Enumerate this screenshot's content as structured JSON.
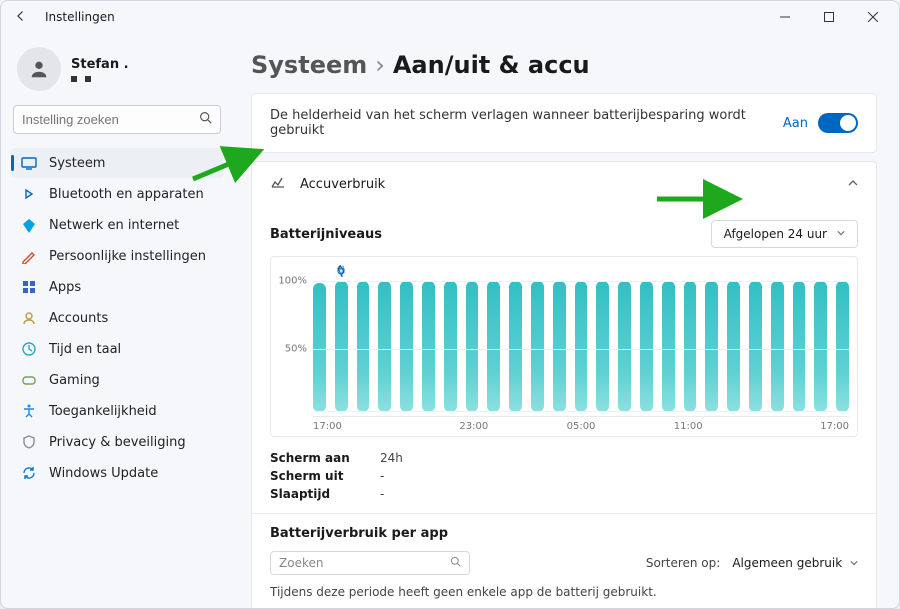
{
  "window": {
    "app_title": "Instellingen"
  },
  "user": {
    "name": "Stefan ."
  },
  "search": {
    "placeholder": "Instelling zoeken"
  },
  "nav": {
    "items": [
      {
        "key": "systeem",
        "label": "Systeem",
        "color": "#0067c0"
      },
      {
        "key": "bluetooth",
        "label": "Bluetooth en apparaten",
        "color": "#0067c0"
      },
      {
        "key": "netwerk",
        "label": "Netwerk en internet",
        "color": "#00a3e0"
      },
      {
        "key": "persoonlijk",
        "label": "Persoonlijke instellingen",
        "color": "#d14b2b"
      },
      {
        "key": "apps",
        "label": "Apps",
        "color": "#3564c5"
      },
      {
        "key": "accounts",
        "label": "Accounts",
        "color": "#c29a4a"
      },
      {
        "key": "tijd",
        "label": "Tijd en taal",
        "color": "#2aa9bd"
      },
      {
        "key": "gaming",
        "label": "Gaming",
        "color": "#7aa34a"
      },
      {
        "key": "toegankelijkheid",
        "label": "Toegankelijkheid",
        "color": "#1f8adf"
      },
      {
        "key": "privacy",
        "label": "Privacy & beveiliging",
        "color": "#8c8c8c"
      },
      {
        "key": "update",
        "label": "Windows Update",
        "color": "#0078d4"
      }
    ],
    "active_key": "systeem"
  },
  "breadcrumb": {
    "parent": "Systeem",
    "sep": "›",
    "current": "Aan/uit & accu"
  },
  "brightness": {
    "label": "De helderheid van het scherm verlagen wanneer batterijbesparing wordt gebruikt",
    "state_label": "Aan",
    "on": true
  },
  "usage": {
    "header": "Accuverbruik",
    "levels_title": "Batterijniveaus",
    "range_label": "Afgelopen 24 uur",
    "y_axis": {
      "l100": "100%",
      "l50": "50%"
    },
    "x_axis": [
      "17:00",
      "23:00",
      "05:00",
      "11:00",
      "17:00"
    ],
    "stats": {
      "screen_on_label": "Scherm aan",
      "screen_on_value": "24h",
      "screen_off_label": "Scherm uit",
      "screen_off_value": "-",
      "sleep_label": "Slaaptijd",
      "sleep_value": "-"
    },
    "per_app": {
      "title": "Batterijverbruik per app",
      "search_placeholder": "Zoeken",
      "sort_label": "Sorteren op:",
      "sort_value": "Algemeen gebruik",
      "empty_note": "Tijdens deze periode heeft geen enkele app de batterij gebruikt."
    }
  },
  "chart_data": {
    "type": "bar",
    "title": "Batterijniveaus",
    "ylabel": "%",
    "ylim": [
      0,
      100
    ],
    "x_ticks": [
      "17:00",
      "23:00",
      "05:00",
      "11:00",
      "17:00"
    ],
    "categories": [
      "17:00",
      "18:00",
      "19:00",
      "20:00",
      "21:00",
      "22:00",
      "23:00",
      "00:00",
      "01:00",
      "02:00",
      "03:00",
      "04:00",
      "05:00",
      "06:00",
      "07:00",
      "08:00",
      "09:00",
      "10:00",
      "11:00",
      "12:00",
      "13:00",
      "14:00",
      "15:00",
      "16:00",
      "17:00"
    ],
    "values": [
      98,
      99,
      99,
      99,
      99,
      99,
      99,
      99,
      99,
      99,
      99,
      99,
      99,
      99,
      99,
      99,
      99,
      99,
      99,
      99,
      99,
      99,
      99,
      99,
      99
    ],
    "charging_markers": [
      1
    ]
  }
}
